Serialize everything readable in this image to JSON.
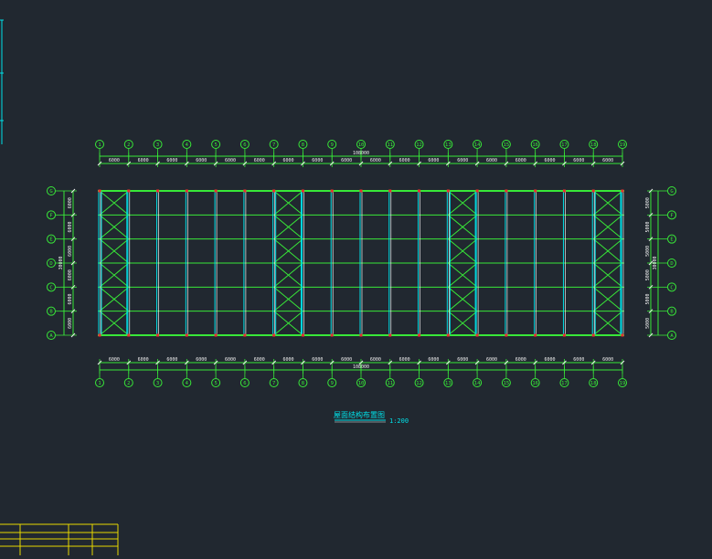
{
  "drawing": {
    "total_length_label": "108000",
    "total_width_label": "30000",
    "title": "屋面结构布置图",
    "scale": "1:200"
  },
  "grid_x_labels": [
    "1",
    "2",
    "3",
    "4",
    "5",
    "6",
    "7",
    "8",
    "9",
    "10",
    "11",
    "12",
    "13",
    "14",
    "15",
    "16",
    "17",
    "18",
    "19"
  ],
  "grid_y_labels": [
    "G",
    "F",
    "E",
    "D",
    "C",
    "B",
    "A"
  ],
  "top_spacings": [
    "6000",
    "6000",
    "6000",
    "6000",
    "6000",
    "6000",
    "6000",
    "6000",
    "6000",
    "6000",
    "6000",
    "6000",
    "6000",
    "6000",
    "6000",
    "6000",
    "6000",
    "6000"
  ],
  "bottom_spacings": [
    "6000",
    "6000",
    "6000",
    "6000",
    "6000",
    "6000",
    "6000",
    "6000",
    "6000",
    "6000",
    "6000",
    "6000",
    "6000",
    "6000",
    "6000",
    "6000",
    "6000",
    "6000"
  ],
  "left_spacings": [
    "6000",
    "6000",
    "6000",
    "6000",
    "6000",
    "6000"
  ],
  "right_spacings": [
    "5000",
    "5000",
    "5000",
    "5000",
    "5000",
    "5000"
  ],
  "braced_bays": [
    0,
    6,
    12,
    17
  ],
  "colors": {
    "background": "#212830",
    "structure": "#38e838",
    "purlin": "#00e0e8",
    "white": "#f0f0f0",
    "frame": "#e8d800",
    "node": "#e83030"
  }
}
